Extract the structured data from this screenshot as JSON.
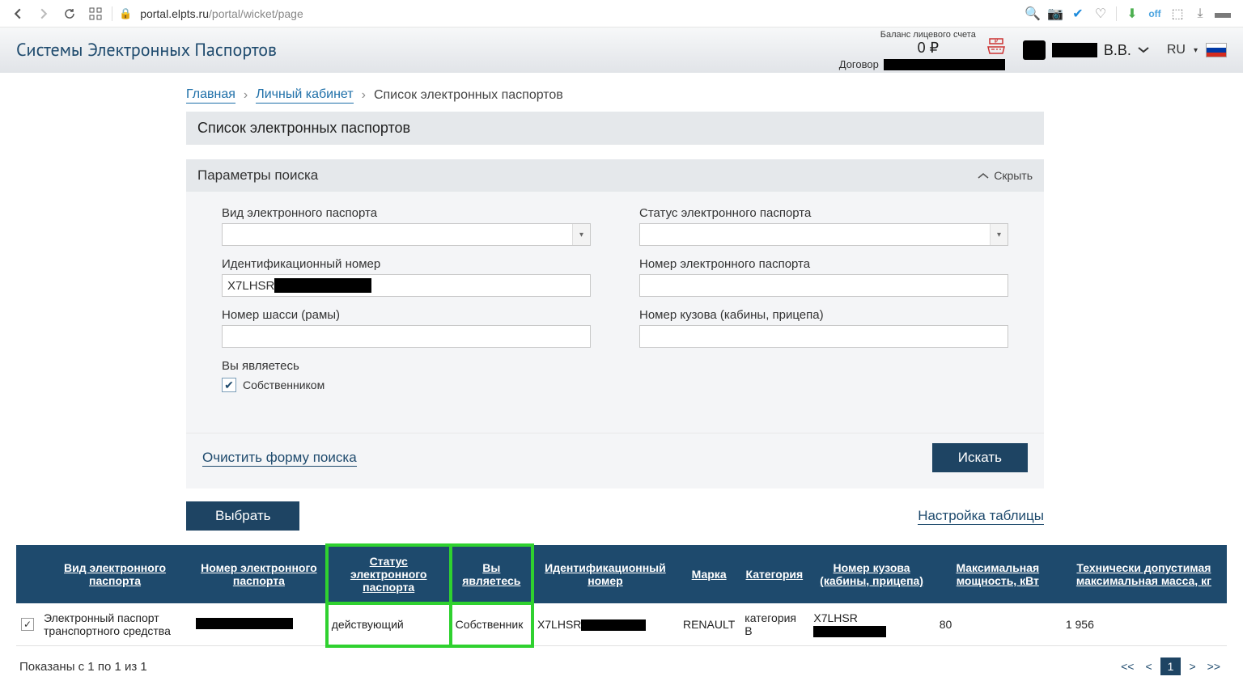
{
  "browser": {
    "url_domain": "portal.elpts.ru",
    "url_path": "/portal/wicket/page"
  },
  "header": {
    "site_title": "Системы Электронных Паспортов",
    "balance_label": "Баланс лицевого счета",
    "balance_value": "0 ₽",
    "contract_label": "Договор",
    "user_initials": "В.В.",
    "lang": "RU"
  },
  "breadcrumb": {
    "home": "Главная",
    "account": "Личный кабинет",
    "current": "Список электронных паспортов"
  },
  "panel": {
    "list_title": "Список электронных паспортов",
    "params_title": "Параметры поиска",
    "collapse_label": "Скрыть"
  },
  "form": {
    "type_label": "Вид электронного паспорта",
    "status_label": "Статус электронного паспорта",
    "ident_label": "Идентификационный номер",
    "ident_value": "X7LHSR",
    "epass_num_label": "Номер электронного паспорта",
    "chassis_label": "Номер шасси (рамы)",
    "body_label": "Номер кузова (кабины, прицепа)",
    "you_are_label": "Вы являетесь",
    "owner_checkbox": "Собственником",
    "clear_form": "Очистить форму поиска",
    "search_btn": "Искать"
  },
  "mid": {
    "select_btn": "Выбрать",
    "table_settings": "Настройка таблицы"
  },
  "table": {
    "headers": {
      "type": "Вид электронного паспорта",
      "number": "Номер электронного паспорта",
      "status": "Статус электронного паспорта",
      "you_are": "Вы являетесь",
      "ident": "Идентификационный номер",
      "brand": "Марка",
      "category": "Категория",
      "body_num": "Номер кузова (кабины, прицепа)",
      "power": "Максимальная мощность, кВт",
      "mass": "Технически допустимая максимальная масса, кг"
    },
    "row": {
      "type": "Электронный паспорт транспортного средства",
      "status": "действующий",
      "you_are": "Собственник",
      "ident_prefix": "X7LHSR",
      "brand": "RENAULT",
      "category": "категория B",
      "body_prefix": "X7LHSR",
      "power": "80",
      "mass": "1 956"
    },
    "shown": "Показаны с 1 по 1 из 1",
    "pager": {
      "first": "<<",
      "prev": "<",
      "current": "1",
      "next": ">",
      "last": ">>"
    }
  }
}
